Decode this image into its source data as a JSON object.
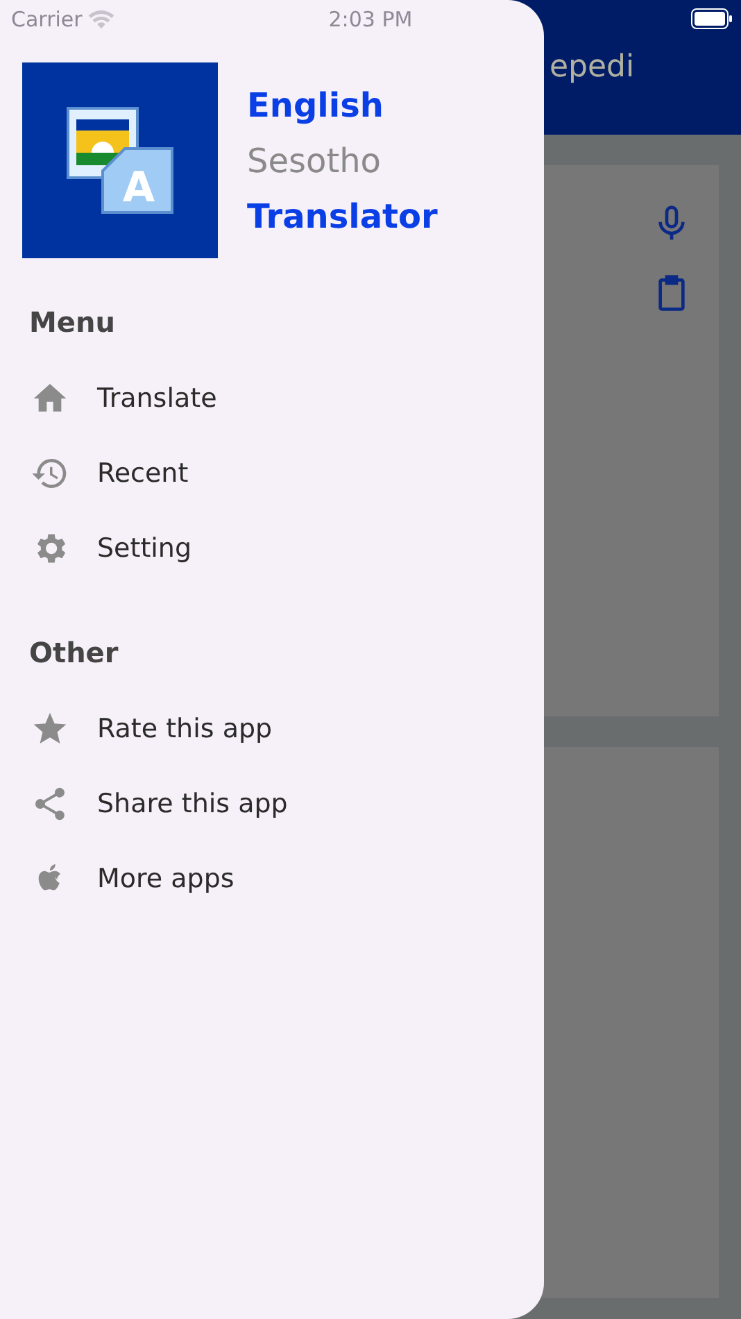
{
  "status_bar": {
    "carrier": "Carrier",
    "time": "2:03 PM"
  },
  "background": {
    "title": "epedi"
  },
  "drawer": {
    "logo_letter": "A",
    "header_lines": [
      {
        "text": "English",
        "kind": "accent"
      },
      {
        "text": "Sesotho",
        "kind": "muted"
      },
      {
        "text": "Translator",
        "kind": "accent"
      }
    ],
    "sections": [
      {
        "title": "Menu",
        "items": [
          {
            "label": "Translate"
          },
          {
            "label": "Recent"
          },
          {
            "label": "Setting"
          }
        ]
      },
      {
        "title": "Other",
        "items": [
          {
            "label": "Rate this app"
          },
          {
            "label": "Share this app"
          },
          {
            "label": "More apps"
          }
        ]
      }
    ]
  }
}
